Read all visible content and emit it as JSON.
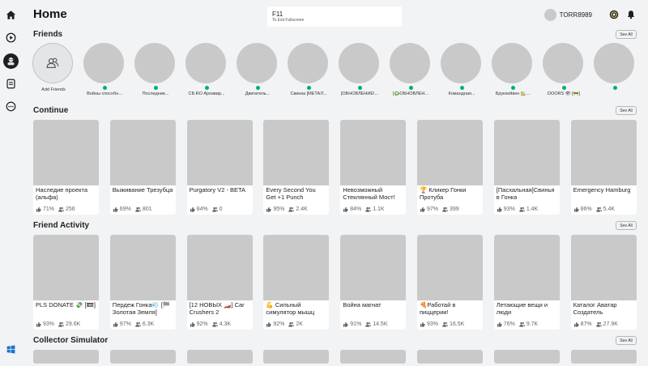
{
  "header": {
    "title": "Home",
    "search": {
      "value": "F11",
      "hint": "To Exit Fullscreen"
    },
    "username": "TORR8989"
  },
  "sidebar": {
    "items": [
      {
        "icon": "home-icon"
      },
      {
        "icon": "play-icon"
      },
      {
        "icon": "avatar-icon"
      },
      {
        "icon": "chat-icon"
      },
      {
        "icon": "more-icon"
      }
    ],
    "footer_icon": "windows-logo-icon"
  },
  "see_all_label": "See All",
  "friends": {
    "title": "Friends",
    "add_label": "Add Friends",
    "items": [
      "Войны способн...",
      "Последние...",
      "СБ:RO Архивир...",
      "Двигатель...",
      "Свинка [МЕТАЛ...",
      "[ОБНОВЛЕНИЕ!...",
      "[♻️ОБНОВЛЕН...",
      "Командная...",
      "Брукхейвен 🏡...",
      "DOORS 👁 [🚧]",
      ""
    ]
  },
  "continue": {
    "title": "Continue",
    "games": [
      {
        "name": "Наследие проекта (альфа)",
        "rating": "71%",
        "players": "256"
      },
      {
        "name": "Выживание Трезубца",
        "rating": "69%",
        "players": "801"
      },
      {
        "name": "Purgatory V2 - BETA",
        "rating": "84%",
        "players": "0"
      },
      {
        "name": "Every Second You Get +1 Punch",
        "rating": "95%",
        "players": "2.4K"
      },
      {
        "name": "Невозможный Стеклянный Мост!",
        "rating": "84%",
        "players": "1.1K"
      },
      {
        "name": "🏆 Кликер Гонки Протуба",
        "rating": "97%",
        "players": "399"
      },
      {
        "name": "[Пасхальная]Свинья в Гонка",
        "rating": "93%",
        "players": "1.4K"
      },
      {
        "name": "Emergency Hamburg",
        "rating": "86%",
        "players": "5.4K"
      }
    ]
  },
  "friend_activity": {
    "title": "Friend Activity",
    "games": [
      {
        "name": "PLS DONATE 💸 [📼]",
        "rating": "93%",
        "players": "29.6K"
      },
      {
        "name": "Пердеж Гонка💨 [🏁Золотая Земля]",
        "rating": "97%",
        "players": "6.3K"
      },
      {
        "name": "[12 НОВЫХ 🏎️] Car Crushers 2",
        "rating": "92%",
        "players": "4.3K"
      },
      {
        "name": "💪 Сильный симулятор мышц",
        "rating": "92%",
        "players": "2K"
      },
      {
        "name": "Война магнат",
        "rating": "91%",
        "players": "14.5K"
      },
      {
        "name": "🍕Работай в пиццерии!",
        "rating": "93%",
        "players": "16.5K"
      },
      {
        "name": "Летающие вещи и люди",
        "rating": "76%",
        "players": "9.7K"
      },
      {
        "name": "Каталог Аватар Создатель",
        "rating": "87%",
        "players": "27.9K"
      }
    ]
  },
  "collector": {
    "title": "Collector Simulator"
  },
  "colors": {
    "online": "#00b06f",
    "placeholder": "#c9c9c9",
    "background": "#f2f3f5"
  }
}
